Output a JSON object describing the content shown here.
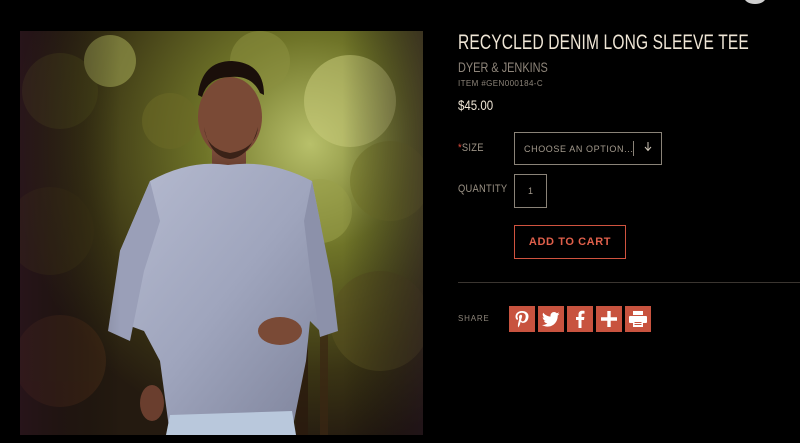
{
  "product": {
    "title": "RECYCLED DENIM LONG SLEEVE TEE",
    "brand": "DYER & JENKINS",
    "sku": "ITEM #GEN000184-C",
    "price": "$45.00"
  },
  "options": {
    "size_required_mark": "*",
    "size_label": "SIZE",
    "size_placeholder": "CHOOSE AN OPTION...",
    "size_arrow_icon": "arrow-down-icon",
    "quantity_label": "QUANTITY",
    "quantity_value": "1"
  },
  "cart": {
    "add_label": "ADD TO CART"
  },
  "share": {
    "label": "SHARE",
    "icons": [
      "pinterest-icon",
      "twitter-icon",
      "facebook-icon",
      "plus-icon",
      "print-icon"
    ]
  },
  "colors": {
    "accent": "#c8533f",
    "background": "#000000",
    "text": "#efe6d6",
    "muted": "#8c8479"
  }
}
